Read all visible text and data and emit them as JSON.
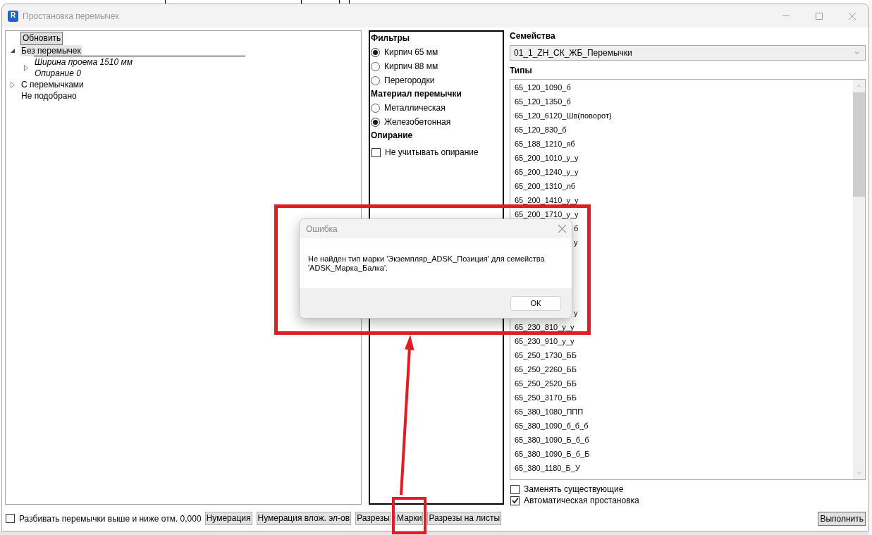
{
  "window": {
    "icon_text": "R",
    "title": "Простановка перемычек"
  },
  "tree": {
    "refresh_button": "Обновить",
    "items": [
      {
        "label": "Без перемычек",
        "expandable": true,
        "expanded": true,
        "selected": true,
        "children": [
          {
            "lines": [
              "Ширина проема 1510 мм",
              "Опирание 0"
            ],
            "expandable": true,
            "expanded": false,
            "selected": false
          }
        ]
      },
      {
        "label": "С перемычками",
        "expandable": true,
        "expanded": false,
        "selected": false
      },
      {
        "label": "Не подобрано",
        "expandable": false,
        "selected": false
      }
    ]
  },
  "filters": {
    "sections": [
      {
        "heading": "Фильтры",
        "options": [
          {
            "kind": "radio",
            "label": "Кирпич 65 мм",
            "selected": true
          },
          {
            "kind": "radio",
            "label": "Кирпич 88 мм",
            "selected": false
          },
          {
            "kind": "radio",
            "label": "Перегородки",
            "selected": false
          }
        ]
      },
      {
        "heading": "Материал перемычки",
        "options": [
          {
            "kind": "radio",
            "label": "Металлическая",
            "selected": false
          },
          {
            "kind": "radio",
            "label": "Железобетонная",
            "selected": true
          }
        ]
      },
      {
        "heading": "Опирание",
        "options": [
          {
            "kind": "checkbox",
            "label": "Не учитывать опирание",
            "checked": false
          }
        ]
      }
    ]
  },
  "families": {
    "label": "Семейства",
    "value": "01_1_ZH_СК_ЖБ_Перемычки"
  },
  "types": {
    "label": "Типы",
    "items_above": [
      {
        "text": "65_120_1090_б",
        "selected": false
      },
      {
        "text": "65_120_1350_б",
        "selected": false
      },
      {
        "text": "65_120_6120_Шв(поворот)",
        "selected": false
      },
      {
        "text": "65_120_830_б",
        "selected": false
      },
      {
        "text": "65_188_1210_яб",
        "selected": false
      },
      {
        "text": "65_200_1010_у_у",
        "selected": false
      },
      {
        "text": "65_200_1240_у_у",
        "selected": false
      },
      {
        "text": "65_200_1310_лб",
        "selected": false
      },
      {
        "text": "65_200_1410_у_у",
        "selected": false
      },
      {
        "text": "65_200_1710_у_у",
        "selected": false
      }
    ],
    "covered_fragments": [
      "б",
      "у",
      "у"
    ],
    "items_below": [
      {
        "text": "65_230_810_у_у",
        "selected": false
      },
      {
        "text": "65_230_910_у_у",
        "selected": false
      },
      {
        "text": "65_250_1730_ББ",
        "selected": false
      },
      {
        "text": "65_250_2260_ББ",
        "selected": false
      },
      {
        "text": "65_250_2520_ББ",
        "selected": false
      },
      {
        "text": "65_250_3170_ББ",
        "selected": false
      },
      {
        "text": "65_380_1080_ППП",
        "selected": false
      },
      {
        "text": "65_380_1090_б_б_б",
        "selected": false
      },
      {
        "text": "65_380_1090_Б_б_б",
        "selected": false
      },
      {
        "text": "65_380_1090_Б_б_Б",
        "selected": false
      },
      {
        "text": "65_380_1180_Б_У",
        "selected": false
      }
    ]
  },
  "options": [
    {
      "label": "Заменять существующие",
      "checked": false
    },
    {
      "label": "Автоматическая простановка",
      "checked": true
    }
  ],
  "run_button": "Выполнить",
  "bottom_bar": {
    "split_option": {
      "label": "Разбивать перемычки выше и ниже отм. 0,000",
      "checked": false
    },
    "buttons": [
      "Нумерация",
      "Нумерация влож. эл-ов",
      "Разрезы",
      "Марки",
      "Разрезы на листы"
    ]
  },
  "dialog": {
    "title": "Ошибка",
    "message": "Не найден тип марки 'Экземпляр_ADSK_Позиция' для семейства 'ADSK_Марка_Балка'.",
    "button": "ОК"
  }
}
